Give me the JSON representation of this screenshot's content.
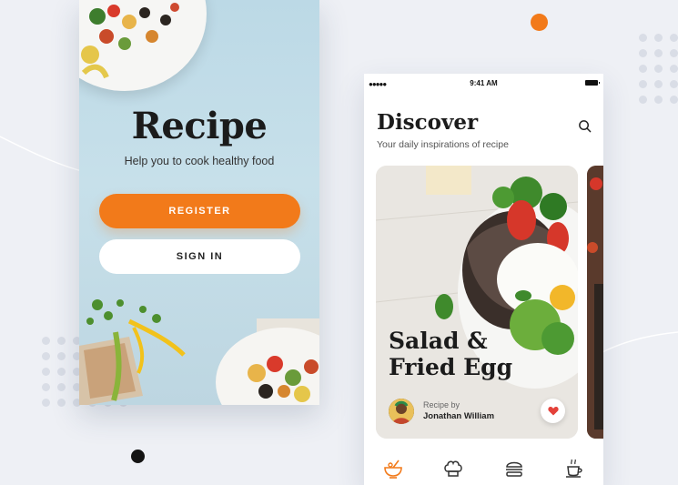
{
  "onboarding": {
    "brand": "Recipe",
    "tagline": "Help you to cook healthy food",
    "register_label": "REGISTER",
    "signin_label": "SIGN IN"
  },
  "discover": {
    "status_time": "9:41 AM",
    "signal": "●●●●●",
    "title": "Discover",
    "subtitle": "Your daily inspirations of recipe",
    "card": {
      "title": "Salad &\nFried Egg",
      "recipe_by": "Recipe by",
      "author": "Jonathan William"
    },
    "tabs": [
      "bowl-icon",
      "chef-hat-icon",
      "burger-icon",
      "coffee-icon"
    ]
  },
  "colors": {
    "accent": "#f27a1a",
    "background": "#eef0f5"
  }
}
